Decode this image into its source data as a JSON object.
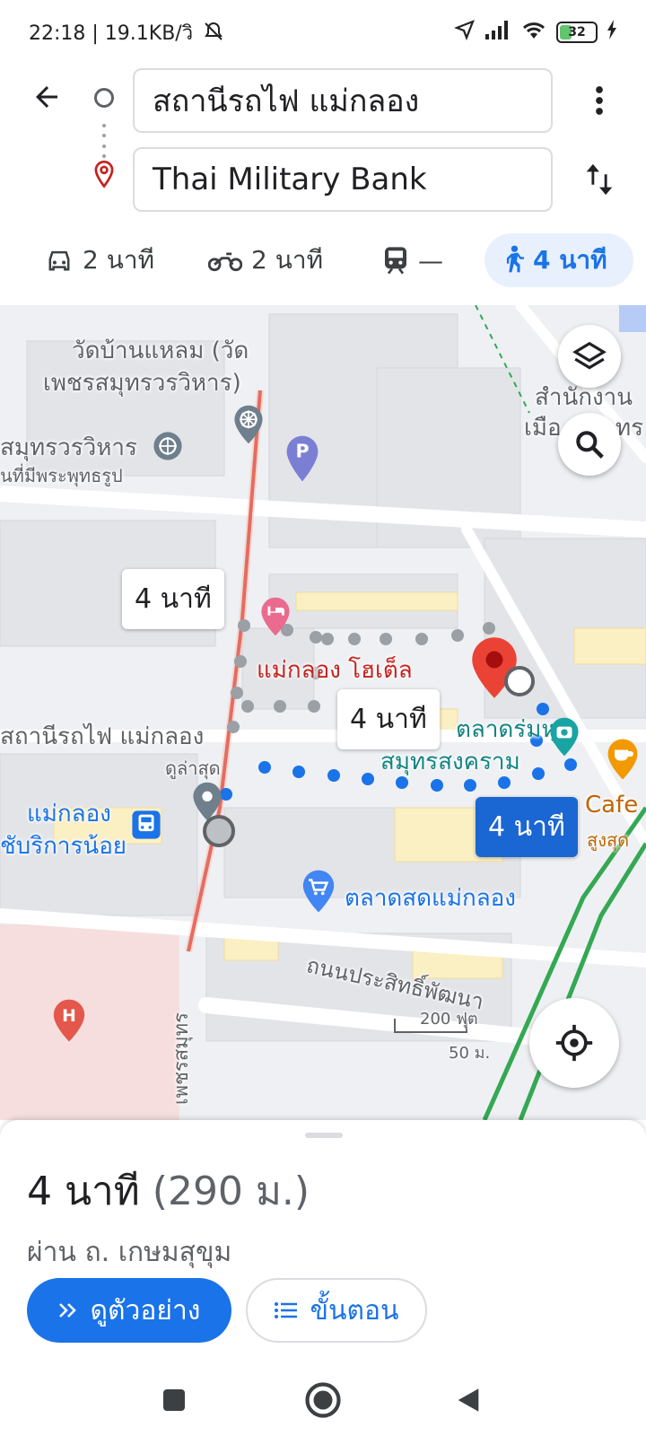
{
  "status_bar": {
    "time_net": "22:18 | 19.1KB/วิ",
    "battery": "32",
    "icons": [
      "mute-icon",
      "location-icon",
      "signal-icon",
      "wifi-icon",
      "battery-icon",
      "charging-icon"
    ]
  },
  "header": {
    "origin": "สถานีรถไฟ แม่กลอง",
    "destination": "Thai Military Bank"
  },
  "modes": [
    {
      "icon": "car-icon",
      "label": "2 นาที"
    },
    {
      "icon": "motorcycle-icon",
      "label": "2 นาที"
    },
    {
      "icon": "transit-icon",
      "label": "—"
    },
    {
      "icon": "walk-icon",
      "label": "4 นาที",
      "active": true
    }
  ],
  "map": {
    "labels": {
      "temple1": "วัดบ้านแหลม (วัด",
      "temple2": "เพชรสมุทรวรวิหาร)",
      "temple3": "สมุทรวรวิหาร",
      "temple4": "นที่มีพระพุทธรูป",
      "office1": "สำนักงาน",
      "office2": "เมือง",
      "office3": "ทร",
      "hotel": "แม่กลอง โฮเต็ล",
      "station": "สถานีรถไฟ แม่กลอง",
      "latest": "ดูล่าสุด",
      "maeklong1": "แม่กลอง",
      "maeklong2": "ชับริการน้อย",
      "umbrella1": "ตลาดร่มหุบ",
      "umbrella2": "สมุทรสงคราม",
      "cafe1": "Cafe",
      "cafe2": "สูงสุด",
      "market": "ตลาดสดแม่กลอง",
      "road": "ถนนประสิทธิ์พัฒนา",
      "street": "เพชรสมุทร",
      "scale_ft": "200 ฟุต",
      "scale_m": "50 ม."
    },
    "route_times": {
      "alt1": "4 นาที",
      "alt2": "4 นาที",
      "selected": "4 นาที"
    }
  },
  "sheet": {
    "duration": "4 นาที",
    "distance": "(290 ม.)",
    "via": "ผ่าน ถ. เกษมสุขุม",
    "preview_label": "ดูตัวอย่าง",
    "steps_label": "ขั้นตอน"
  },
  "colors": {
    "accent": "#1a73e8",
    "route_selected": "#1a66d2",
    "route_alt": "#9aa0a6",
    "rail": "#e0463d",
    "pin": "#ea4335"
  }
}
